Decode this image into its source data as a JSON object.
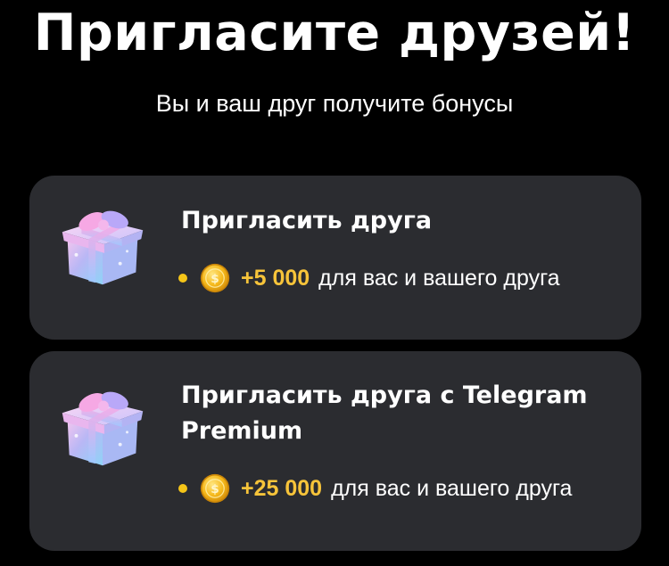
{
  "header": {
    "title": "Пригласите друзей!",
    "subtitle": "Вы и ваш друг получите бонусы"
  },
  "cards": [
    {
      "title": "Пригласить друга",
      "icon": "gift-box-icon",
      "reward": {
        "amount": "+5 000",
        "text": "для вас и вашего друга",
        "icon": "coin-icon"
      }
    },
    {
      "title": "Пригласить друга с Telegram Premium",
      "icon": "gift-box-icon",
      "reward": {
        "amount": "+25 000",
        "text": "для вас и вашего друга",
        "icon": "coin-icon"
      }
    }
  ],
  "colors": {
    "background": "#000000",
    "card": "#2b2c30",
    "accent": "#f7c43a",
    "text": "#ffffff"
  }
}
